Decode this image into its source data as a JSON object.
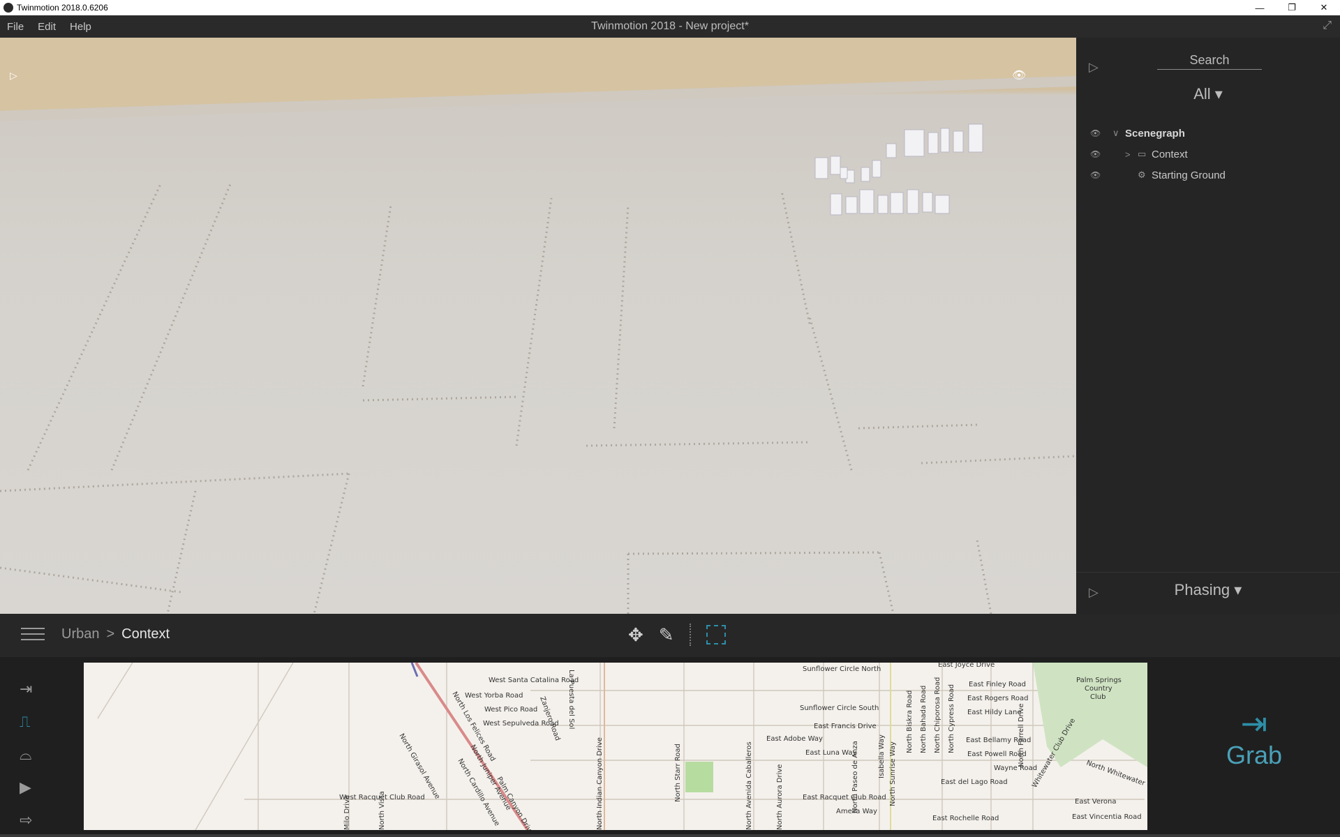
{
  "titlebar": {
    "title": "Twinmotion 2018.0.6206",
    "minimize": "—",
    "restore": "❐",
    "close": "✕"
  },
  "menubar": {
    "items": [
      "File",
      "Edit",
      "Help"
    ],
    "window_title": "Twinmotion 2018 - New project*",
    "expand_icon": "⤢"
  },
  "viewport": {
    "play_icon": "▷",
    "eye_icon": "👁"
  },
  "right_panel": {
    "play_icon": "▷",
    "search_placeholder": "Search",
    "filter_label": "All ▾",
    "tree": [
      {
        "label": "Scenegraph",
        "caret": "∨",
        "icon": ""
      },
      {
        "label": "Context",
        "caret": ">",
        "icon": "▭"
      },
      {
        "label": "Starting Ground",
        "caret": "",
        "icon": "⚙"
      }
    ],
    "phasing_label": "Phasing ▾",
    "phasing_play_icon": "▷"
  },
  "toolbar": {
    "breadcrumb": [
      "Urban",
      "Context"
    ],
    "separator": ">",
    "move_icon": "✥",
    "picker_icon": "✎"
  },
  "sidebar": {
    "icons": [
      "import-icon",
      "waveform-icon",
      "leaf-icon",
      "media-icon",
      "export-icon"
    ],
    "glyphs": [
      "⇥",
      "⎍",
      "⌓",
      "▶",
      "⇨"
    ]
  },
  "map": {
    "roads": [
      "West Santa Catalina Road",
      "West Yorba Road",
      "West Pico Road",
      "West Sepulveda Road",
      "Zanjero Road",
      "La Puesta del Sol",
      "North Los Felices Road",
      "North Girasol Avenue",
      "North Cardillo Avenue",
      "North Juniper Avenue",
      "Palm Canyon Drive",
      "North Indian Canyon Drive",
      "North Starr Road",
      "North Avenida Caballeros",
      "North Aurora Drive",
      "West Racquet Club Road",
      "Sunflower Circle North",
      "Sunflower Circle South",
      "East Francis Drive",
      "East Adobe Way",
      "East Luna Way",
      "East Racquet Club Road",
      "Amelia Way",
      "North Paseo de Anza",
      "Isabella Way",
      "North Sunrise Way",
      "North Biskra Road",
      "North Bahada Road",
      "North Chiporosa Road",
      "North Cypress Road",
      "East Joyce Drive",
      "East Finley Road",
      "East Rogers Road",
      "East Hildy Lane",
      "East Bellamy Road",
      "East Powell Road",
      "Wayne Road",
      "East del Lago Road",
      "East Rochelle Road",
      "North Farrell Drive",
      "Whitewater Club Drive",
      "North Whitewater Club",
      "East Verona",
      "East Vincentia Road",
      "Palm Springs",
      "Country",
      "Club",
      "Milo Drive",
      "North Vista"
    ],
    "zoom_icon": "🔍"
  },
  "grab": {
    "icon": "⇥",
    "label": "Grab"
  }
}
